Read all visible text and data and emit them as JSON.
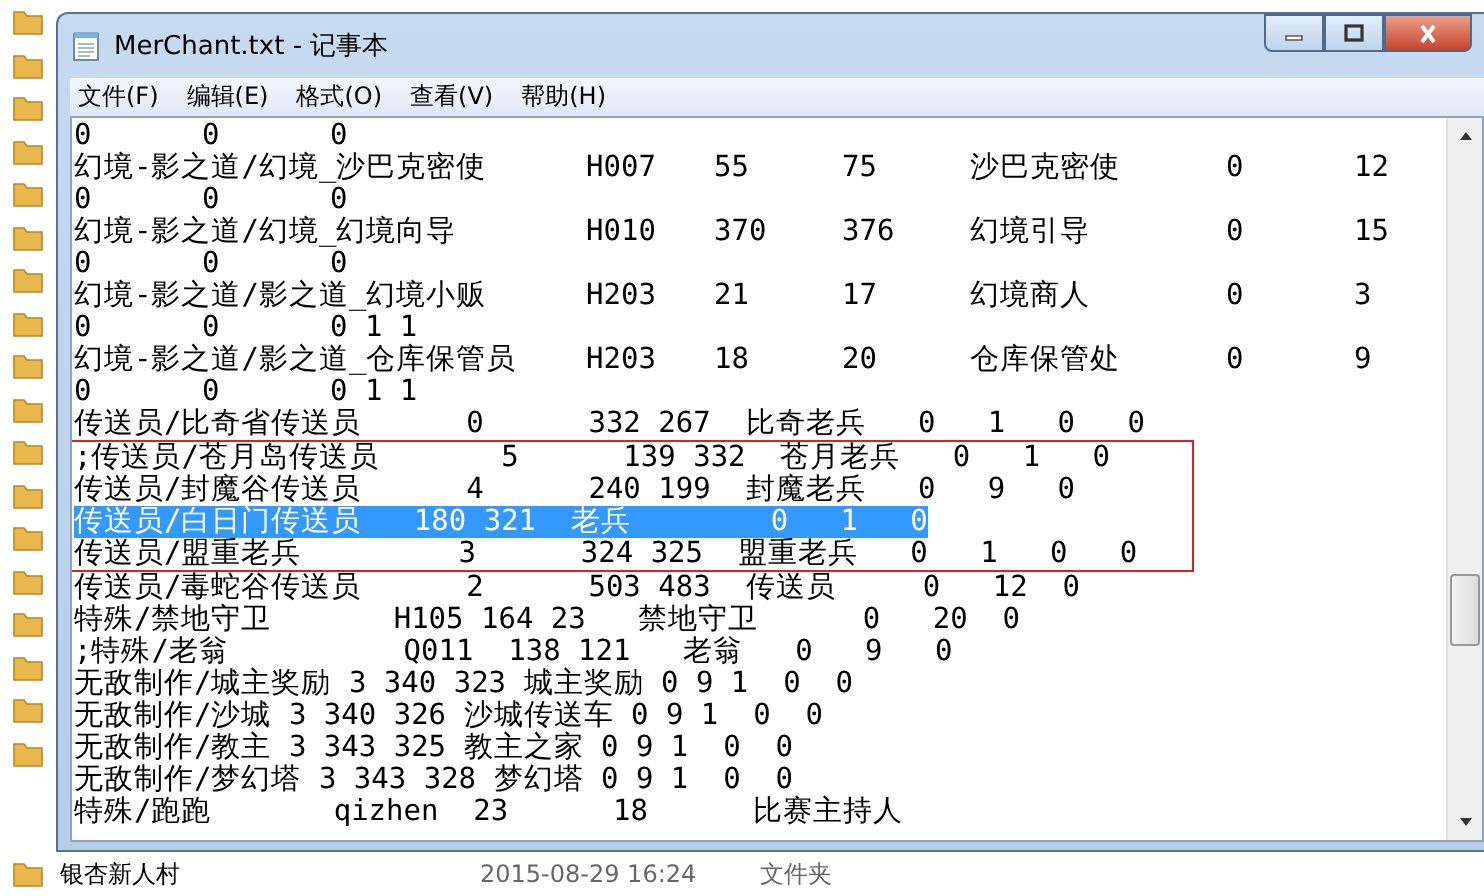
{
  "window": {
    "title": "MerChant.txt - 记事本"
  },
  "menu": [
    "文件(F)",
    "编辑(E)",
    "格式(O)",
    "查看(V)",
    "帮助(H)"
  ],
  "lines": [
    {
      "text": "0\t0\t0",
      "selected": false,
      "annotated": false
    },
    {
      "text": "幻境-影之道/幻境_沙巴克密使\tH007\t55\t75\t沙巴克密使\t0\t12",
      "selected": false,
      "annotated": false
    },
    {
      "text": "0\t0\t0",
      "selected": false,
      "annotated": false
    },
    {
      "text": "幻境-影之道/幻境_幻境向导\tH010\t370\t376\t幻境引导\t0\t15",
      "selected": false,
      "annotated": false
    },
    {
      "text": "0\t0\t0",
      "selected": false,
      "annotated": false
    },
    {
      "text": "幻境-影之道/影之道_幻境小贩\tH203\t21\t17\t幻境商人\t0\t3",
      "selected": false,
      "annotated": false
    },
    {
      "text": "0\t0\t0 1 1",
      "selected": false,
      "annotated": false
    },
    {
      "text": "幻境-影之道/影之道_仓库保管员\tH203\t18\t20\t仓库保管处\t0\t9",
      "selected": false,
      "annotated": false
    },
    {
      "text": "0\t0\t0 1 1",
      "selected": false,
      "annotated": false
    },
    {
      "text": "传送员/比奇省传送员      0      332 267  比奇老兵   0   1   0   0",
      "selected": false,
      "annotated": false
    },
    {
      "text": ";传送员/苍月岛传送员       5      139 332  苍月老兵   0   1   0",
      "selected": false,
      "annotated": true
    },
    {
      "text": "传送员/封魔谷传送员      4      240 199  封魔老兵   0   9   0",
      "selected": false,
      "annotated": true
    },
    {
      "text": "传送员/白日门传送员   180 321  老兵        0   1   0",
      "selected": true,
      "annotated": true
    },
    {
      "text": "传送员/盟重老兵         3      324 325  盟重老兵   0   1   0   0",
      "selected": false,
      "annotated": true
    },
    {
      "text": "传送员/毒蛇谷传送员      2      503 483  传送员     0   12  0",
      "selected": false,
      "annotated": false
    },
    {
      "text": "特殊/禁地守卫       H105 164 23   禁地守卫      0   20  0",
      "selected": false,
      "annotated": false
    },
    {
      "text": ";特殊/老翁          Q011  138 121   老翁   0   9   0",
      "selected": false,
      "annotated": false
    },
    {
      "text": "无敌制作/城主奖励 3 340 323 城主奖励 0 9 1  0  0",
      "selected": false,
      "annotated": false
    },
    {
      "text": "无敌制作/沙城 3 340 326 沙城传送车 0 9 1  0  0",
      "selected": false,
      "annotated": false
    },
    {
      "text": "无敌制作/教主 3 343 325 教主之家 0 9 1  0  0",
      "selected": false,
      "annotated": false
    },
    {
      "text": "无敌制作/梦幻塔 3 343 328 梦幻塔 0 9 1  0  0",
      "selected": false,
      "annotated": false
    },
    {
      "text": "特殊/跑跑       qizhen  23      18      比赛主持人",
      "selected": false,
      "annotated": false
    }
  ],
  "explorer_row": {
    "name": "银杏新人村",
    "date": "2015-08-29 16:24",
    "type": "文件夹"
  }
}
